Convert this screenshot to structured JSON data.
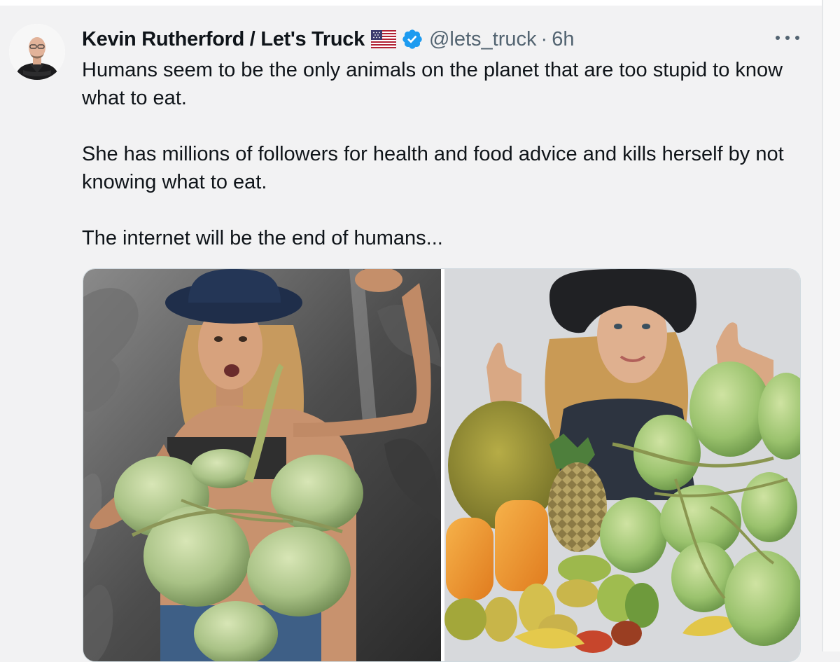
{
  "tweet": {
    "author": {
      "display_name": "Kevin Rutherford / Let's Truck",
      "handle": "@lets_truck",
      "flag_icon": "us-flag-icon",
      "verified_icon": "verified-badge-icon"
    },
    "separator": "·",
    "time": "6h",
    "more_icon": "more-options-icon",
    "text": {
      "paragraph_1": "Humans seem to be the only animals on the planet that are too stupid to know what to eat.",
      "paragraph_2": "She has millions of followers for health and food advice and kills herself by not knowing what to eat.",
      "paragraph_3": "The internet will be the end of humans..."
    },
    "media": {
      "photos": [
        {
          "description": "Woman in hat flexing arm while holding a bunch of green coconuts, grayscale background"
        },
        {
          "description": "Woman in hat giving two thumbs up behind a pile of tropical fruit"
        }
      ]
    }
  },
  "colors": {
    "text_primary": "#0f1419",
    "text_secondary": "#536471",
    "verified_blue": "#1d9bf0",
    "background": "#f2f2f3"
  }
}
